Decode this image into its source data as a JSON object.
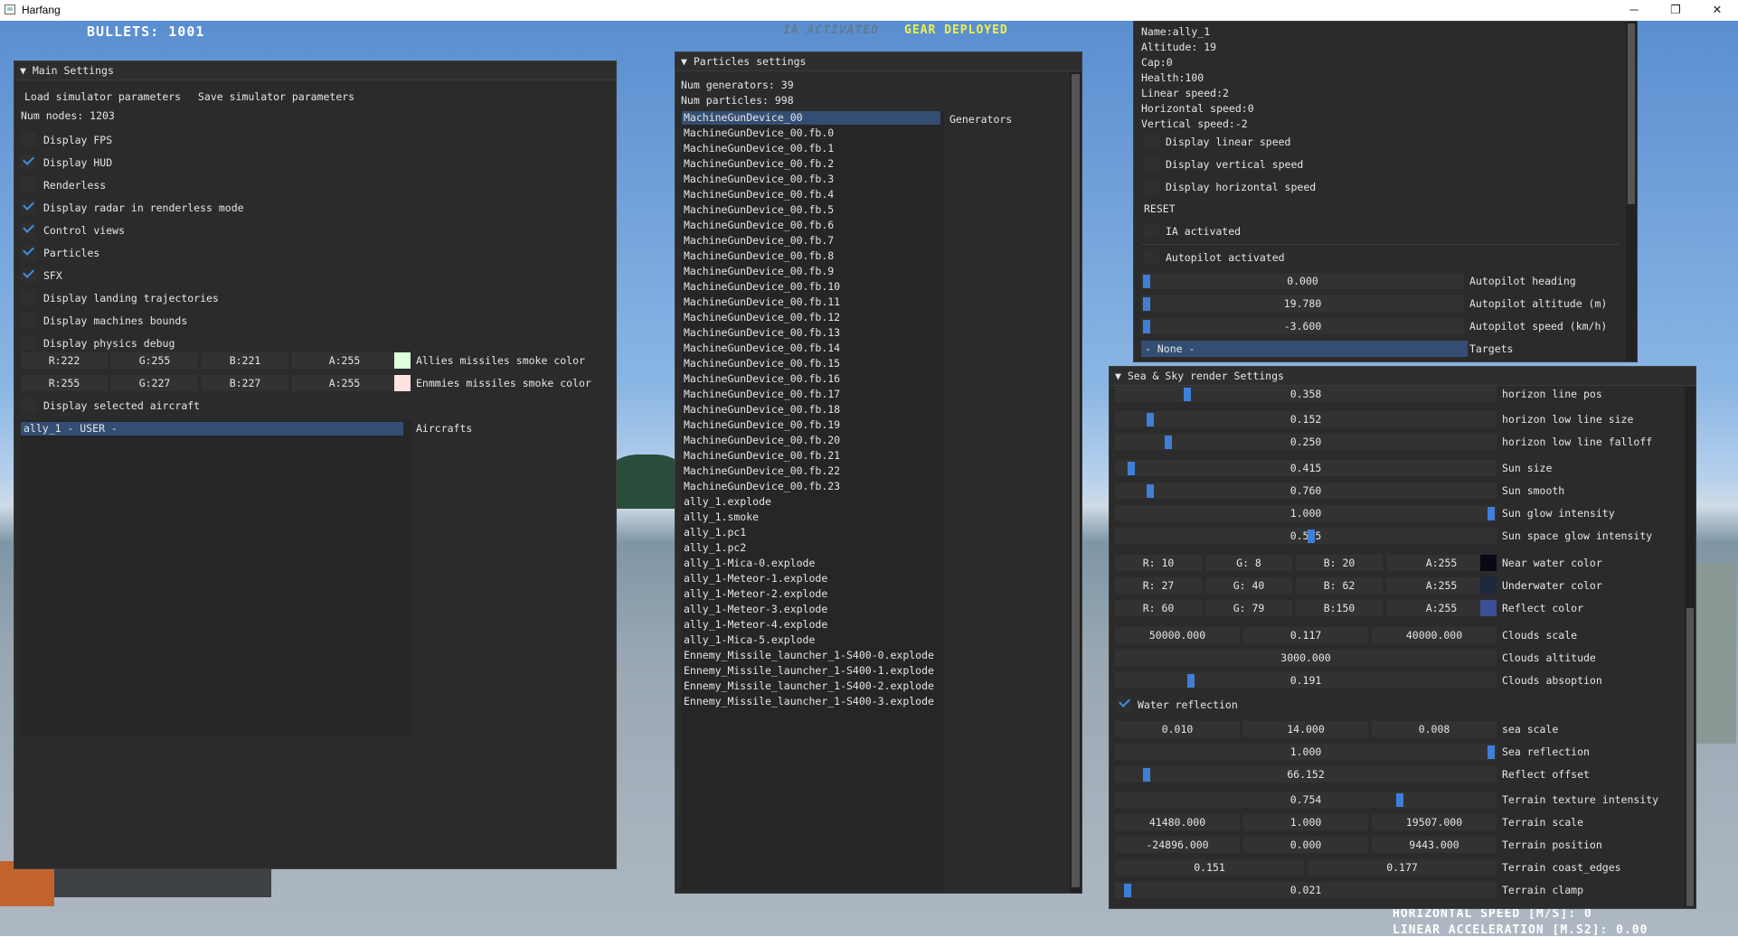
{
  "window": {
    "title": "Harfang",
    "minimize": "─",
    "maximize": "❐",
    "close": "✕"
  },
  "hud": {
    "bullets": "BULLETS: 1001",
    "ia": "IA ACTIVATED",
    "gear": "GEAR DEPLOYED",
    "horizontal_speed": "HORIZONTAL SPEED [M/S]: 0",
    "linear_accel": "LINEAR ACCELERATION [M.S2]: 0.00",
    "colors": {
      "ia": "#5f7a8f",
      "gear": "#f1f14a",
      "bullets": "#ffffff"
    }
  },
  "main": {
    "title": "Main Settings",
    "load": "Load simulator parameters",
    "save": "Save simulator parameters",
    "num_nodes": "Num nodes: 1203",
    "checks": [
      {
        "label": "Display FPS",
        "on": false
      },
      {
        "label": "Display HUD",
        "on": true
      },
      {
        "label": "Renderless",
        "on": false
      },
      {
        "label": "Display radar in renderless mode",
        "on": true
      },
      {
        "label": "Control views",
        "on": true
      },
      {
        "label": "Particles",
        "on": true
      },
      {
        "label": "SFX",
        "on": true
      },
      {
        "label": "Display landing trajectories",
        "on": false
      },
      {
        "label": "Display machines bounds",
        "on": false
      },
      {
        "label": "Display physics debug",
        "on": false
      }
    ],
    "allies": {
      "r": "R:222",
      "g": "G:255",
      "b": "B:221",
      "a": "A:255",
      "label": "Allies missiles smoke color",
      "swatch": "#deffdd"
    },
    "enemies": {
      "r": "R:255",
      "g": "G:227",
      "b": "B:227",
      "a": "A:255",
      "label": "Enmmies missiles smoke color",
      "swatch": "#ffe3e3"
    },
    "display_selected": "Display selected aircraft",
    "aircraft_item": "ally_1 - USER -",
    "aircrafts_label": "Aircrafts"
  },
  "particles": {
    "title": "Particles settings",
    "num_generators": "Num generators: 39",
    "num_particles": "Num particles: 998",
    "generators_label": "Generators",
    "items": [
      "MachineGunDevice_00",
      "MachineGunDevice_00.fb.0",
      "MachineGunDevice_00.fb.1",
      "MachineGunDevice_00.fb.2",
      "MachineGunDevice_00.fb.3",
      "MachineGunDevice_00.fb.4",
      "MachineGunDevice_00.fb.5",
      "MachineGunDevice_00.fb.6",
      "MachineGunDevice_00.fb.7",
      "MachineGunDevice_00.fb.8",
      "MachineGunDevice_00.fb.9",
      "MachineGunDevice_00.fb.10",
      "MachineGunDevice_00.fb.11",
      "MachineGunDevice_00.fb.12",
      "MachineGunDevice_00.fb.13",
      "MachineGunDevice_00.fb.14",
      "MachineGunDevice_00.fb.15",
      "MachineGunDevice_00.fb.16",
      "MachineGunDevice_00.fb.17",
      "MachineGunDevice_00.fb.18",
      "MachineGunDevice_00.fb.19",
      "MachineGunDevice_00.fb.20",
      "MachineGunDevice_00.fb.21",
      "MachineGunDevice_00.fb.22",
      "MachineGunDevice_00.fb.23",
      "ally_1.explode",
      "ally_1.smoke",
      "ally_1.pc1",
      "ally_1.pc2",
      "ally_1-Mica-0.explode",
      "ally_1-Meteor-1.explode",
      "ally_1-Meteor-2.explode",
      "ally_1-Meteor-3.explode",
      "ally_1-Meteor-4.explode",
      "ally_1-Mica-5.explode",
      "Ennemy_Missile_launcher_1-S400-0.explode",
      "Ennemy_Missile_launcher_1-S400-1.explode",
      "Ennemy_Missile_launcher_1-S400-2.explode",
      "Ennemy_Missile_launcher_1-S400-3.explode"
    ]
  },
  "aircraft": {
    "info": [
      "Name:ally_1",
      "Altitude: 19",
      "Cap:0",
      "Health:100",
      "Linear speed:2",
      "Horizontal speed:0",
      "Vertical speed:-2"
    ],
    "checks": [
      {
        "label": "Display linear speed",
        "on": false
      },
      {
        "label": "Display vertical speed",
        "on": false
      },
      {
        "label": "Display horizontal speed",
        "on": false
      }
    ],
    "reset": "RESET",
    "ia_activated": "IA activated",
    "autopilot_activated": "Autopilot activated",
    "sliders": [
      {
        "value": "0.000",
        "label": "Autopilot heading",
        "level": 0.0
      },
      {
        "value": "19.780",
        "label": "Autopilot altitude (m)",
        "level": 0.0
      },
      {
        "value": "-3.600",
        "label": "Autopilot speed (km/h)",
        "level": 0.0
      }
    ],
    "target_value": "- None -",
    "targets_label": "Targets"
  },
  "sea": {
    "title": "Sea & Sky render Settings",
    "sliders1": [
      {
        "value": "0.358",
        "label": "horizon line pos",
        "level": 0.18
      },
      {
        "value": "0.152",
        "label": "horizon low line size",
        "level": 0.08
      },
      {
        "value": "0.250",
        "label": "horizon low line falloff",
        "level": 0.13
      },
      {
        "value": "0.415",
        "label": "Sun size",
        "level": 0.03
      },
      {
        "value": "0.760",
        "label": "Sun smooth",
        "level": 0.08
      },
      {
        "value": "1.000",
        "label": "Sun glow intensity",
        "level": 1.0
      },
      {
        "value": "0.515",
        "label": "Sun space glow intensity",
        "level": 0.515
      }
    ],
    "colors": [
      {
        "r": "R: 10",
        "g": "G:  8",
        "b": "B: 20",
        "a": "A:255",
        "label": "Near water color",
        "swatch": "#0a0814"
      },
      {
        "r": "R: 27",
        "g": "G: 40",
        "b": "B: 62",
        "a": "A:255",
        "label": "Underwater color",
        "swatch": "#1b283e"
      },
      {
        "r": "R: 60",
        "g": "G: 79",
        "b": "B:150",
        "a": "A:255",
        "label": "Reflect color",
        "swatch": "#3c4f96"
      }
    ],
    "clouds_scale": {
      "v1": "50000.000",
      "v2": "0.117",
      "v3": "40000.000",
      "label": "Clouds scale"
    },
    "clouds_altitude": {
      "value": "3000.000",
      "label": "Clouds altitude"
    },
    "clouds_absorption": {
      "value": "0.191",
      "label": "Clouds absoption",
      "level": 0.19
    },
    "water_reflection": {
      "label": "Water reflection",
      "on": true
    },
    "sea_scale": {
      "v1": "0.010",
      "v2": "14.000",
      "v3": "0.008",
      "label": "sea scale"
    },
    "sea_reflection": {
      "value": "1.000",
      "label": "Sea reflection",
      "level": 1.0
    },
    "reflect_offset": {
      "value": "66.152",
      "label": "Reflect offset",
      "level": 0.07
    },
    "terrain_texture": {
      "value": "0.754",
      "label": "Terrain texture intensity",
      "level": 0.754
    },
    "terrain_scale": {
      "v1": "41480.000",
      "v2": "1.000",
      "v3": "19507.000",
      "label": "Terrain scale"
    },
    "terrain_position": {
      "v1": "-24896.000",
      "v2": "0.000",
      "v3": "9443.000",
      "label": "Terrain position"
    },
    "terrain_coast": {
      "v1": "0.151",
      "v2": "0.177",
      "label": "Terrain coast_edges"
    },
    "terrain_clamp": {
      "value": "0.021",
      "label": "Terrain clamp",
      "level": 0.02
    }
  }
}
